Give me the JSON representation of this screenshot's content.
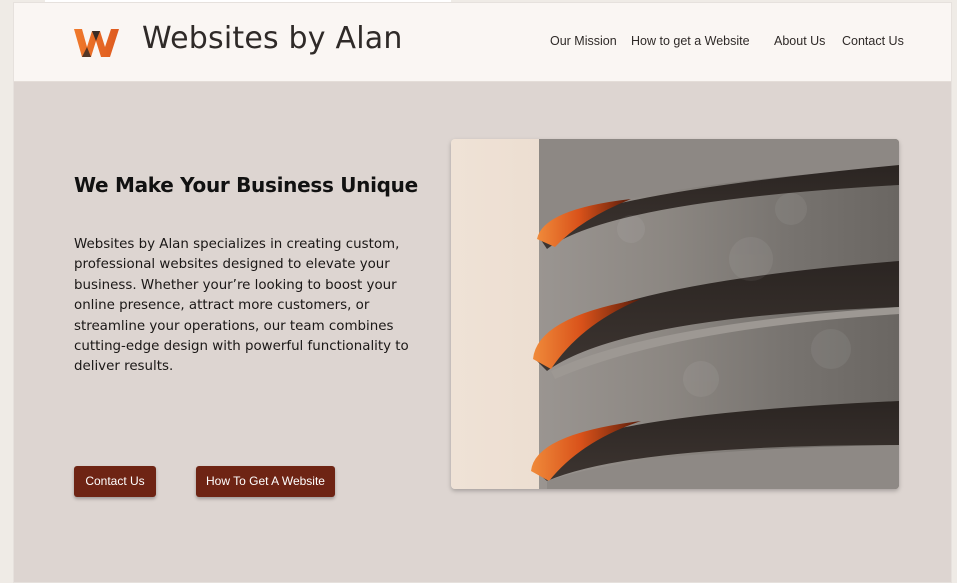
{
  "header": {
    "brand": "Websites by Alan",
    "logo_icon": "w-logo-icon",
    "nav": [
      "Our Mission",
      "How to get a Website",
      "About Us",
      "Contact Us"
    ]
  },
  "hero": {
    "title": "We Make Your Business Unique",
    "body": "Websites by Alan specializes in creating custom, professional websites designed to elevate your business.  Whether your’re looking to boost your online presence, attract more customers, or streamline your operations, our team combines cutting-edge design with powerful functionality to deliver results.",
    "buttons": {
      "contact": "Contact Us",
      "how": "How To Get A Website"
    },
    "image_icon": "concrete-spiral-building-image"
  },
  "colors": {
    "accent_orange": "#e8692a",
    "button_brown": "#6e2414",
    "page_background": "#ddd5d1",
    "header_background": "#faf6f3"
  }
}
